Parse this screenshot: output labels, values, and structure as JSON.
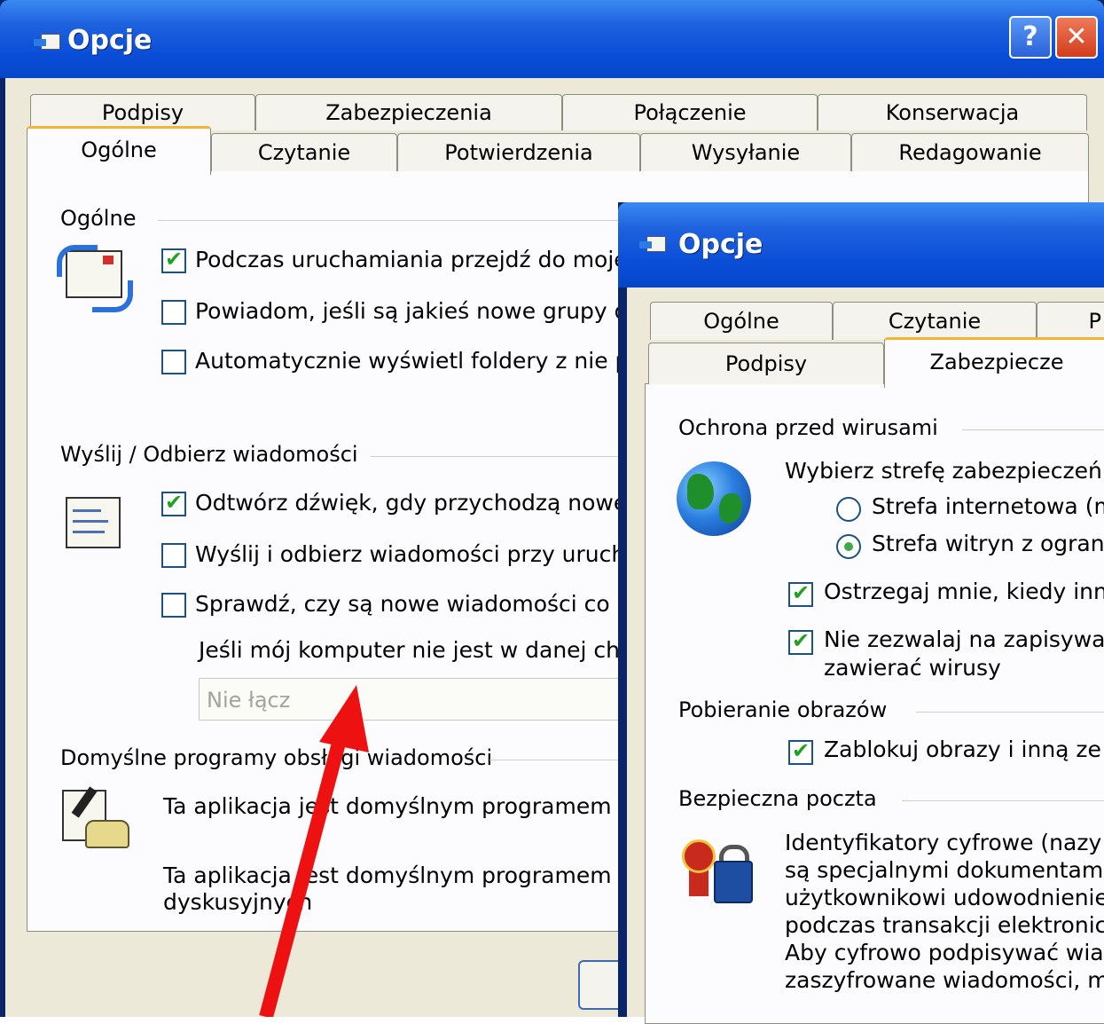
{
  "back_window": {
    "title": "Opcje",
    "help_label": "?",
    "close_label": "✕",
    "tabs_row1": [
      "Podpisy",
      "Zabezpieczenia",
      "Połączenie",
      "Konserwacja"
    ],
    "tabs_row2": [
      "Ogólne",
      "Czytanie",
      "Potwierdzenia",
      "Wysyłanie",
      "Redagowanie"
    ],
    "groups": {
      "general": {
        "label": "Ogólne",
        "options": [
          {
            "label": "Podczas uruchamiania przejdź do mojego",
            "checked": true
          },
          {
            "label": "Powiadom, jeśli są jakieś nowe grupy dys",
            "checked": false
          },
          {
            "label": "Automatycznie wyświetl foldery z nie prze",
            "checked": false
          }
        ]
      },
      "send_receive": {
        "label": "Wyślij / Odbierz wiadomości",
        "options": [
          {
            "label": "Odtwórz dźwięk, gdy przychodzą nowe w",
            "checked": true
          },
          {
            "label": "Wyślij i odbierz wiadomości przy urucham",
            "checked": false
          },
          {
            "label": "Sprawdź, czy są nowe wiadomości co",
            "checked": false
          }
        ],
        "offline_text": "Jeśli mój komputer nie jest w danej chwili",
        "connect_dropdown": "Nie łącz"
      },
      "default_programs": {
        "label": "Domyślne programy obsługi wiadomości",
        "mail_text": "Ta aplikacja jest domyślnym programem obsł",
        "news_text_line1": "Ta aplikacja jest domyślnym programem obsł",
        "news_text_line2": "dyskusyjnych"
      }
    }
  },
  "front_window": {
    "title": "Opcje",
    "tabs_row1": [
      "Ogólne",
      "Czytanie",
      "P"
    ],
    "tabs_row2": [
      "Podpisy",
      "Zabezpiecze"
    ],
    "groups": {
      "virus": {
        "label": "Ochrona przed wirusami",
        "zone_prompt": "Wybierz strefę zabezpieczeń",
        "zones": [
          {
            "label": "Strefa internetowa (m",
            "selected": false
          },
          {
            "label": "Strefa witryn z ograni",
            "selected": true
          }
        ],
        "options": [
          {
            "label": "Ostrzegaj mnie, kiedy inn",
            "checked": true
          },
          {
            "label": "Nie zezwalaj na zapisywa",
            "checked": true
          }
        ],
        "option2_line2": "zawierać wirusy"
      },
      "images": {
        "label": "Pobieranie obrazów",
        "options": [
          {
            "label": "Zablokuj obrazy i inną ze",
            "checked": true
          }
        ]
      },
      "secure_mail": {
        "label": "Bezpieczna poczta",
        "lines": [
          "Identyfikatory cyfrowe (nazy",
          "są specjalnymi dokumentami",
          "użytkownikowi udowodnienie",
          "podczas transakcji elektronic",
          "Aby cyfrowo podpisywać wia",
          "zaszyfrowane wiadomości, m"
        ]
      }
    }
  },
  "colors": {
    "titlebar": "#0a4ed8",
    "dialog_bg": "#ece9d8",
    "annotation_arrow": "#ee1111",
    "check_green": "#21a121"
  }
}
